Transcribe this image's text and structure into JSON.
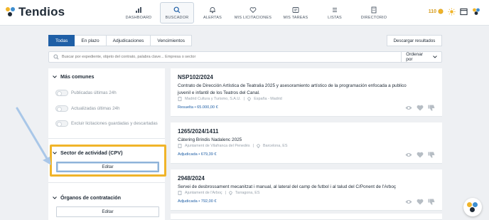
{
  "app": {
    "brand": "Tendios",
    "coins": "110"
  },
  "nav": [
    {
      "label": "DASHBOARD",
      "icon": "bar-chart-icon"
    },
    {
      "label": "BUSCADOR",
      "icon": "search-icon",
      "active": true
    },
    {
      "label": "ALERTAS",
      "icon": "bell-icon"
    },
    {
      "label": "MIS LICITACIONES",
      "icon": "heart-icon"
    },
    {
      "label": "MIS TAREAS",
      "icon": "tasks-icon"
    },
    {
      "label": "LISTAS",
      "icon": "list-icon"
    },
    {
      "label": "DIRECTORIO",
      "icon": "building-icon"
    }
  ],
  "tabs": [
    "Todas",
    "En plazo",
    "Adjudicaciones",
    "Vencimientos"
  ],
  "download_label": "Descargar resultados",
  "search": {
    "placeholder": "Buscar por expediente, objeto del contrato, palabra clave... Empresa o sector",
    "sort_label": "Ordenar por"
  },
  "filters": {
    "common_title": "Más comunes",
    "toggles": [
      "Publicadas últimas 24h",
      "Actualizadas últimas 24h",
      "Excluir licitaciones guardadas y descartadas"
    ],
    "sector_title": "Sector de actividad (CPV)",
    "sector_edit": "Editar",
    "organos_title": "Órganos de contratación",
    "organos_edit": "Editar"
  },
  "results": [
    {
      "number": "NSP102/2024",
      "description": "Contrato de Dirección Artística de Teatralia 2025 y asesoramiento artístico de la programación enfocada a publico juvenil e infantil de los Teatros del Canal.",
      "organization": "Madrid Cultura y Turismo, S.A.U.",
      "location": "España - Madrid",
      "status": "Resuelta • 65.000,00 €"
    },
    {
      "number": "1265/2024/1411",
      "description": "Càtering Brindis Nadalenc 2025",
      "organization": "Ajuntament de Vilafranca del Penedès",
      "location": "Barcelona, ES",
      "status": "Adjudicada • 679,39 €"
    },
    {
      "number": "2948/2024",
      "description": "Servei de desbrossament mecanitzat i manual, al lateral del camp de futbol i al talud del C/Ponent de l'Arboç",
      "organization": "Ajuntament de l'Arboç",
      "location": "Tarragona, ES",
      "status": "Adjudicada • 792,00 €"
    }
  ],
  "colors": {
    "primary": "#1f5fa6",
    "highlight": "#f0b429",
    "coins": "#d49a1a"
  }
}
